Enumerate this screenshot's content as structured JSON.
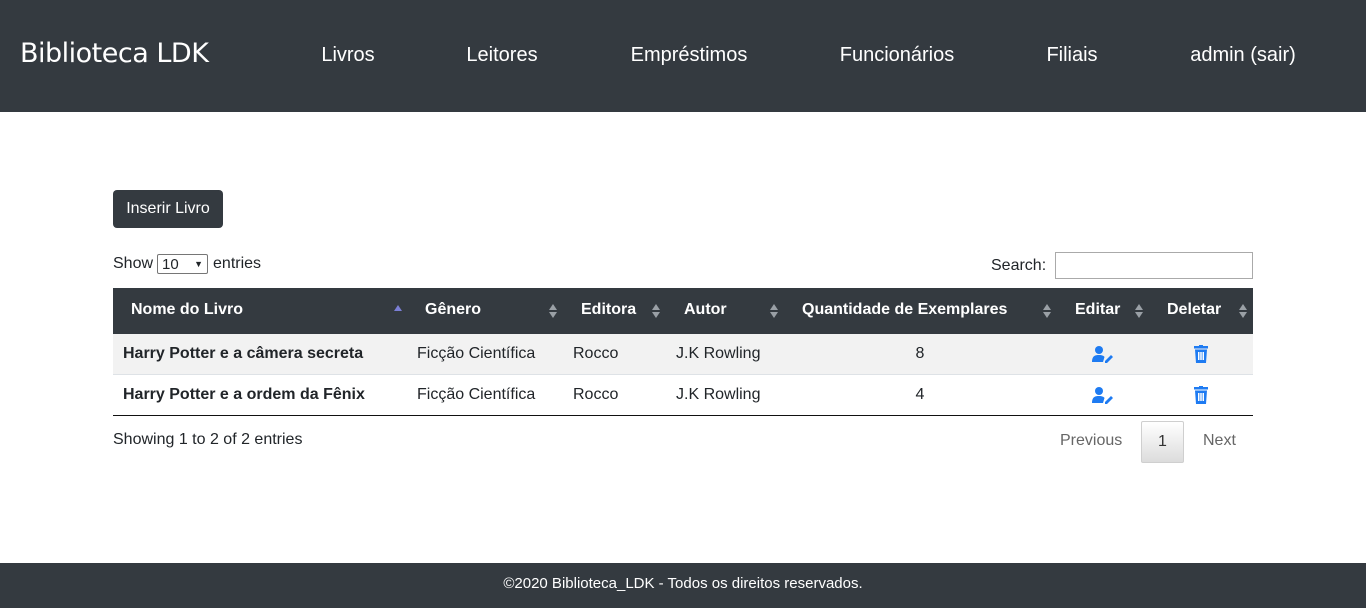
{
  "nav": {
    "brand": "Biblioteca LDK",
    "links": [
      "Livros",
      "Leitores",
      "Empréstimos",
      "Funcionários",
      "Filiais",
      "admin (sair)"
    ]
  },
  "toolbar": {
    "insert_label": "Inserir Livro"
  },
  "length": {
    "show": "Show",
    "value": "10",
    "entries": "entries"
  },
  "search": {
    "label": "Search:",
    "value": ""
  },
  "table": {
    "headers": [
      "Nome do Livro",
      "Gênero",
      "Editora",
      "Autor",
      "Quantidade de Exemplares",
      "Editar",
      "Deletar"
    ],
    "sorted_column": "Nome do Livro",
    "rows": [
      {
        "nome": "Harry Potter e a câmera secreta",
        "genero": "Ficção Científica",
        "editora": "Rocco",
        "autor": "J.K Rowling",
        "quantidade": "8",
        "edit_icon": "user-edit-icon",
        "delete_icon": "trash-icon"
      },
      {
        "nome": "Harry Potter e a ordem da Fênix",
        "genero": "Ficção Científica",
        "editora": "Rocco",
        "autor": "J.K Rowling",
        "quantidade": "4",
        "edit_icon": "user-edit-icon",
        "delete_icon": "trash-icon"
      }
    ]
  },
  "info": "Showing 1 to 2 of 2 entries",
  "pagination": {
    "previous": "Previous",
    "current": "1",
    "next": "Next"
  },
  "footer": "©2020 Biblioteca_LDK - Todos os direitos reservados.",
  "colors": {
    "navbar": "#343a40",
    "icon_blue": "#1e7bf2",
    "sort_active": "#7b7fd6"
  }
}
